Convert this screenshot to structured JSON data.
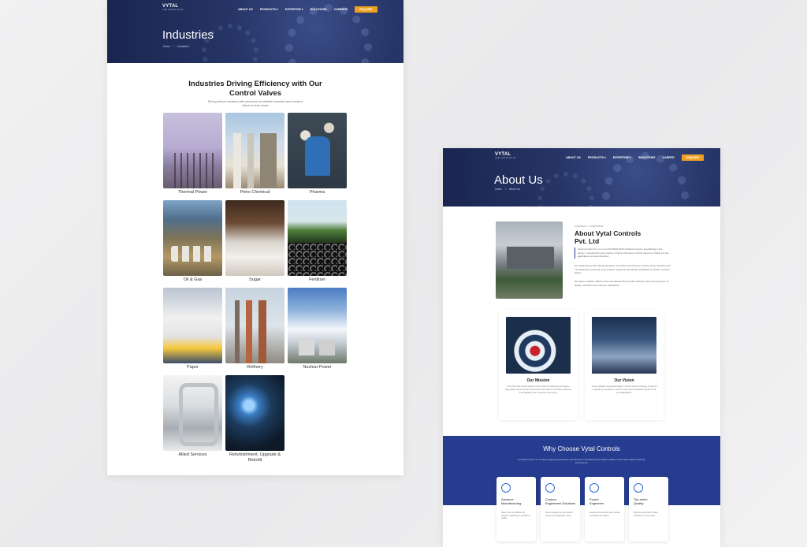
{
  "industries_page": {
    "nav": {
      "logo": "VYTAL",
      "logo_sub": "vytal controls pvt ltd",
      "links": [
        "ABOUT US",
        "PRODUCTS ▾",
        "EXPERTISE ▾",
        "SOLUTIONS",
        "CAREERS"
      ],
      "cta": "ENQUIRE"
    },
    "hero_title": "Industries",
    "breadcrumb": [
      "Home",
      "Industries"
    ],
    "section_title_line1": "Industries Driving Efficiency with Our",
    "section_title_line2": "Control Valves",
    "section_sub_line1": "Driving diverse industries with advanced and reliable industrial valve solutions",
    "section_sub_line2": "tailored to their needs",
    "cards": [
      {
        "caption": "Thermal Power",
        "img": "thermal"
      },
      {
        "caption": "Petro Chemical",
        "img": "petro"
      },
      {
        "caption": "Pharma",
        "img": "pharma"
      },
      {
        "caption": "Oil & Gas",
        "img": "oil"
      },
      {
        "caption": "Sugar",
        "img": "sugar"
      },
      {
        "caption": "Fertilizer",
        "img": "fert"
      },
      {
        "caption": "Paper",
        "img": "paper"
      },
      {
        "caption": "Refinery",
        "img": "refinery"
      },
      {
        "caption": "Nuclear Power",
        "img": "nuclear"
      },
      {
        "caption": "Allied Services",
        "img": "allied"
      },
      {
        "caption": "Refurbishment, Upgrade & Retrofit",
        "img": "refurb"
      }
    ]
  },
  "about_page": {
    "nav": {
      "logo": "VYTAL",
      "logo_sub": "vytal controls pvt ltd",
      "links": [
        "ABOUT US",
        "PRODUCTS ▾",
        "EXPERTISE ▾",
        "INDUSTRIES",
        "CAREER"
      ],
      "cta": "ENQUIRE"
    },
    "hero_title": "About Us",
    "breadcrumb": [
      "Home",
      "About Us"
    ],
    "eyebrow": "COMPANY OVERVIEW",
    "title_line1": "About Vytal Controls",
    "title_line2": "Pvt. Ltd",
    "para1": "Vytal Controls Pvt. Ltd. is an ISO 9001:2015 certified company specializing in the design, manufacturing and supply of high performance control valves for critical service applications across industries.",
    "para2": "Our engineering team brings decades of combined experience in valve sizing, selection and manufacturing, ensuring every product meets the demanding standards of modern process plants.",
    "para3": "We deliver reliable, efficient and cost-effective flow control solutions with a strong focus on quality, precision and customer satisfaction.",
    "mission_title": "Our Mission",
    "mission_text": "To be the most trusted partner in flow control by delivering innovative, high quality control valves and services that improve the safety, efficiency and reliability of our customers' processes.",
    "vision_title": "Our Vision",
    "vision_text": "To be a globally recognised leader in control valve technology, known for engineering excellence, customer focus and sustainable growth for all our stakeholders.",
    "why_title": "Why Choose Vytal Controls",
    "why_sub": "At Vytal Controls, we combine engineering expertise with advanced manufacturing to deliver reliable control valve solutions built for performance.",
    "features": [
      {
        "title_line1": "Advance",
        "title_line2": "Manufacturing",
        "text": "State-of-the-art facilities and precision machining for consistent quality."
      },
      {
        "title_line1": "Custom-",
        "title_line2": "Engineered Solutions",
        "text": "Valves designed to meet specific process and application needs."
      },
      {
        "title_line1": "Expert",
        "title_line2": "Engineers",
        "text": "Experienced team with deep domain knowledge and support."
      },
      {
        "title_line1": "Top-notch",
        "title_line2": "Quality",
        "text": "Rigorous testing and certified processes for every valve."
      }
    ]
  }
}
